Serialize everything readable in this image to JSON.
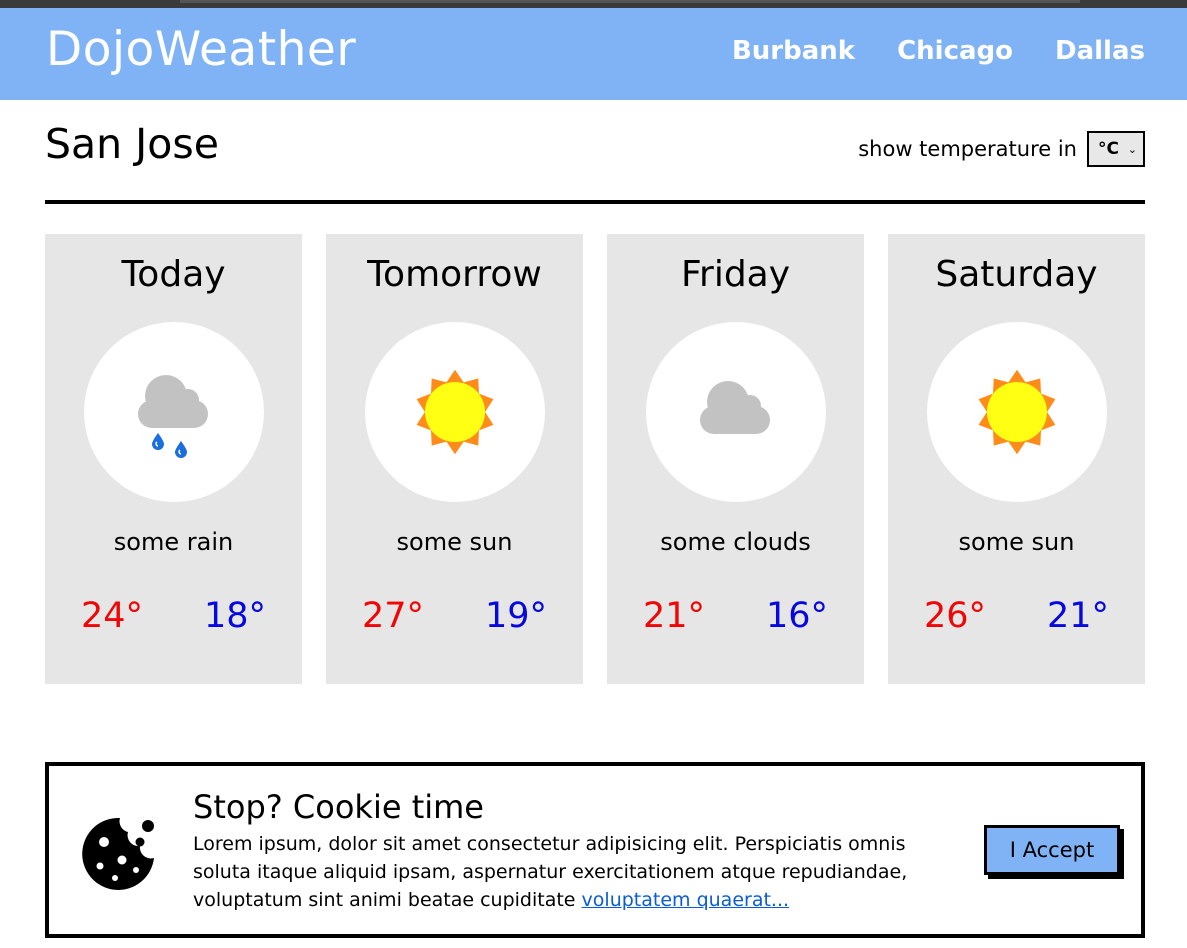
{
  "header": {
    "brand": "DojoWeather",
    "nav": [
      "Burbank",
      "Chicago",
      "Dallas"
    ]
  },
  "location": {
    "city": "San Jose",
    "unit_label": "show temperature in",
    "unit_selected": "°C"
  },
  "forecast": [
    {
      "day": "Today",
      "icon": "rain-cloud-icon",
      "description": "some rain",
      "high": "24°",
      "low": "18°"
    },
    {
      "day": "Tomorrow",
      "icon": "sun-icon",
      "description": "some sun",
      "high": "27°",
      "low": "19°"
    },
    {
      "day": "Friday",
      "icon": "cloud-icon",
      "description": "some clouds",
      "high": "21°",
      "low": "16°"
    },
    {
      "day": "Saturday",
      "icon": "sun-icon",
      "description": "some sun",
      "high": "26°",
      "low": "21°"
    }
  ],
  "cookie": {
    "title": "Stop? Cookie time",
    "text": "Lorem ipsum, dolor sit amet consectetur adipisicing elit. Perspiciatis omnis soluta itaque aliquid ipsam, aspernatur exercitationem atque repudiandae, voluptatum sint animi beatae cupiditate ",
    "link": "voluptatem quaerat...",
    "accept_label": "I Accept"
  },
  "colors": {
    "header_bg": "#80b3f5",
    "card_bg": "#e6e6e6",
    "high_temp": "#f20505",
    "low_temp": "#0707e0",
    "sun_core": "#ffff14",
    "sun_rays": "#ff8c1a",
    "cloud": "#c2c2c2",
    "rain": "#1a6ee0"
  }
}
